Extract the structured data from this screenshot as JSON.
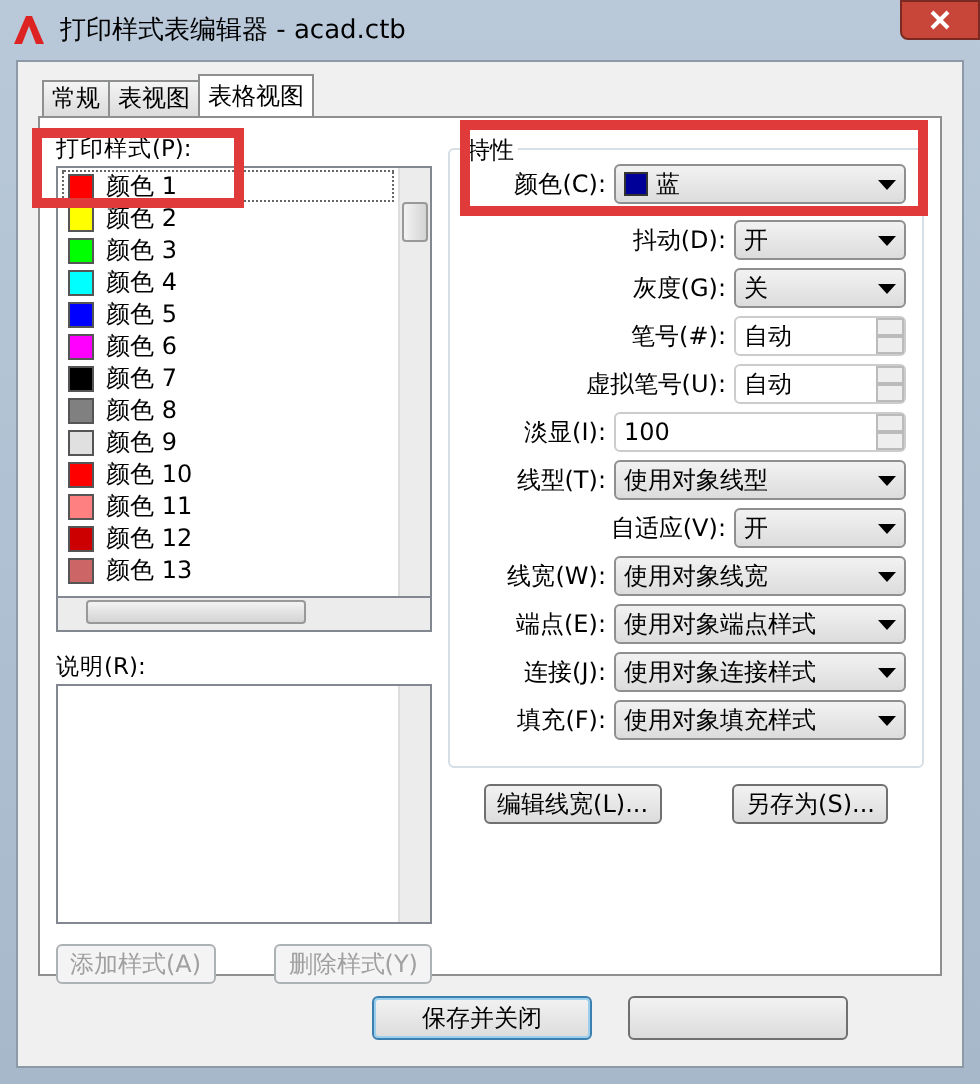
{
  "window": {
    "title": "打印样式表编辑器 - acad.ctb"
  },
  "tabs": [
    {
      "label": "常规",
      "selected": false
    },
    {
      "label": "表视图",
      "selected": false
    },
    {
      "label": "表格视图",
      "selected": true
    }
  ],
  "styles_list": {
    "label": "打印样式(P):",
    "items": [
      {
        "name": "颜色 1",
        "color": "#ff0000",
        "selected": true
      },
      {
        "name": "颜色 2",
        "color": "#ffff00",
        "selected": false
      },
      {
        "name": "颜色 3",
        "color": "#00ff00",
        "selected": false
      },
      {
        "name": "颜色 4",
        "color": "#00ffff",
        "selected": false
      },
      {
        "name": "颜色 5",
        "color": "#0000ff",
        "selected": false
      },
      {
        "name": "颜色 6",
        "color": "#ff00ff",
        "selected": false
      },
      {
        "name": "颜色 7",
        "color": "#000000",
        "selected": false
      },
      {
        "name": "颜色 8",
        "color": "#808080",
        "selected": false
      },
      {
        "name": "颜色 9",
        "color": "#e0e0e0",
        "selected": false
      },
      {
        "name": "颜色 10",
        "color": "#ff0000",
        "selected": false
      },
      {
        "name": "颜色 11",
        "color": "#ff8080",
        "selected": false
      },
      {
        "name": "颜色 12",
        "color": "#cc0000",
        "selected": false
      },
      {
        "name": "颜色 13",
        "color": "#cc6666",
        "selected": false
      }
    ]
  },
  "description": {
    "label": "说明(R):"
  },
  "list_buttons": [
    {
      "label": "添加样式(A)",
      "disabled": true
    },
    {
      "label": "删除样式(Y)",
      "disabled": true
    }
  ],
  "properties": {
    "title": "特性",
    "rows": [
      {
        "label": "颜色(C):",
        "kind": "dropdown",
        "value": "蓝",
        "color": "#000099",
        "wide": true
      },
      {
        "label": "抖动(D):",
        "kind": "dropdown",
        "value": "开",
        "wide": false
      },
      {
        "label": "灰度(G):",
        "kind": "dropdown",
        "value": "关",
        "wide": false
      },
      {
        "label": "笔号(#):",
        "kind": "spinner",
        "value": "自动",
        "wide": false
      },
      {
        "label": "虚拟笔号(U):",
        "kind": "spinner",
        "value": "自动",
        "wide": false
      },
      {
        "label": "淡显(I):",
        "kind": "spinner",
        "value": "100",
        "wide": true
      },
      {
        "label": "线型(T):",
        "kind": "dropdown",
        "value": "使用对象线型",
        "wide": true
      },
      {
        "label": "自适应(V):",
        "kind": "dropdown",
        "value": "开",
        "wide": false
      },
      {
        "label": "线宽(W):",
        "kind": "dropdown",
        "value": "使用对象线宽",
        "wide": true
      },
      {
        "label": "端点(E):",
        "kind": "dropdown",
        "value": "使用对象端点样式",
        "wide": true
      },
      {
        "label": "连接(J):",
        "kind": "dropdown",
        "value": "使用对象连接样式",
        "wide": true
      },
      {
        "label": "填充(F):",
        "kind": "dropdown",
        "value": "使用对象填充样式",
        "wide": true
      }
    ]
  },
  "property_buttons": [
    "编辑线宽(L)...",
    "另存为(S)..."
  ],
  "footer_buttons": [
    "保存并关闭"
  ]
}
